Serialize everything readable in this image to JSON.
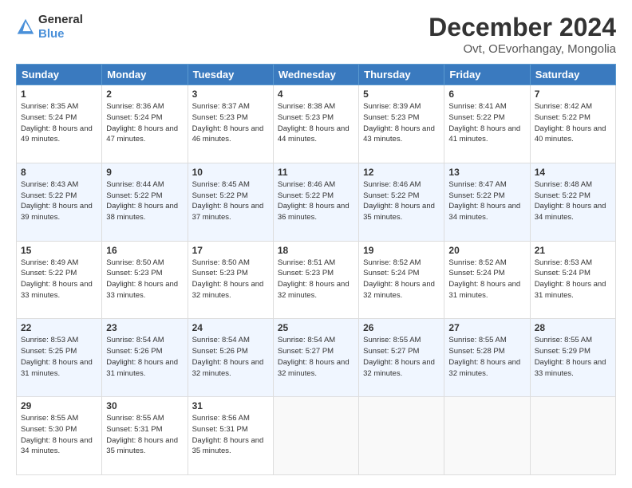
{
  "header": {
    "logo_general": "General",
    "logo_blue": "Blue",
    "main_title": "December 2024",
    "subtitle": "Ovt, OEvorhangay, Mongolia"
  },
  "calendar": {
    "headers": [
      "Sunday",
      "Monday",
      "Tuesday",
      "Wednesday",
      "Thursday",
      "Friday",
      "Saturday"
    ],
    "weeks": [
      [
        {
          "day": "1",
          "sunrise": "Sunrise: 8:35 AM",
          "sunset": "Sunset: 5:24 PM",
          "daylight": "Daylight: 8 hours and 49 minutes."
        },
        {
          "day": "2",
          "sunrise": "Sunrise: 8:36 AM",
          "sunset": "Sunset: 5:24 PM",
          "daylight": "Daylight: 8 hours and 47 minutes."
        },
        {
          "day": "3",
          "sunrise": "Sunrise: 8:37 AM",
          "sunset": "Sunset: 5:23 PM",
          "daylight": "Daylight: 8 hours and 46 minutes."
        },
        {
          "day": "4",
          "sunrise": "Sunrise: 8:38 AM",
          "sunset": "Sunset: 5:23 PM",
          "daylight": "Daylight: 8 hours and 44 minutes."
        },
        {
          "day": "5",
          "sunrise": "Sunrise: 8:39 AM",
          "sunset": "Sunset: 5:23 PM",
          "daylight": "Daylight: 8 hours and 43 minutes."
        },
        {
          "day": "6",
          "sunrise": "Sunrise: 8:41 AM",
          "sunset": "Sunset: 5:22 PM",
          "daylight": "Daylight: 8 hours and 41 minutes."
        },
        {
          "day": "7",
          "sunrise": "Sunrise: 8:42 AM",
          "sunset": "Sunset: 5:22 PM",
          "daylight": "Daylight: 8 hours and 40 minutes."
        }
      ],
      [
        {
          "day": "8",
          "sunrise": "Sunrise: 8:43 AM",
          "sunset": "Sunset: 5:22 PM",
          "daylight": "Daylight: 8 hours and 39 minutes."
        },
        {
          "day": "9",
          "sunrise": "Sunrise: 8:44 AM",
          "sunset": "Sunset: 5:22 PM",
          "daylight": "Daylight: 8 hours and 38 minutes."
        },
        {
          "day": "10",
          "sunrise": "Sunrise: 8:45 AM",
          "sunset": "Sunset: 5:22 PM",
          "daylight": "Daylight: 8 hours and 37 minutes."
        },
        {
          "day": "11",
          "sunrise": "Sunrise: 8:46 AM",
          "sunset": "Sunset: 5:22 PM",
          "daylight": "Daylight: 8 hours and 36 minutes."
        },
        {
          "day": "12",
          "sunrise": "Sunrise: 8:46 AM",
          "sunset": "Sunset: 5:22 PM",
          "daylight": "Daylight: 8 hours and 35 minutes."
        },
        {
          "day": "13",
          "sunrise": "Sunrise: 8:47 AM",
          "sunset": "Sunset: 5:22 PM",
          "daylight": "Daylight: 8 hours and 34 minutes."
        },
        {
          "day": "14",
          "sunrise": "Sunrise: 8:48 AM",
          "sunset": "Sunset: 5:22 PM",
          "daylight": "Daylight: 8 hours and 34 minutes."
        }
      ],
      [
        {
          "day": "15",
          "sunrise": "Sunrise: 8:49 AM",
          "sunset": "Sunset: 5:22 PM",
          "daylight": "Daylight: 8 hours and 33 minutes."
        },
        {
          "day": "16",
          "sunrise": "Sunrise: 8:50 AM",
          "sunset": "Sunset: 5:23 PM",
          "daylight": "Daylight: 8 hours and 33 minutes."
        },
        {
          "day": "17",
          "sunrise": "Sunrise: 8:50 AM",
          "sunset": "Sunset: 5:23 PM",
          "daylight": "Daylight: 8 hours and 32 minutes."
        },
        {
          "day": "18",
          "sunrise": "Sunrise: 8:51 AM",
          "sunset": "Sunset: 5:23 PM",
          "daylight": "Daylight: 8 hours and 32 minutes."
        },
        {
          "day": "19",
          "sunrise": "Sunrise: 8:52 AM",
          "sunset": "Sunset: 5:24 PM",
          "daylight": "Daylight: 8 hours and 32 minutes."
        },
        {
          "day": "20",
          "sunrise": "Sunrise: 8:52 AM",
          "sunset": "Sunset: 5:24 PM",
          "daylight": "Daylight: 8 hours and 31 minutes."
        },
        {
          "day": "21",
          "sunrise": "Sunrise: 8:53 AM",
          "sunset": "Sunset: 5:24 PM",
          "daylight": "Daylight: 8 hours and 31 minutes."
        }
      ],
      [
        {
          "day": "22",
          "sunrise": "Sunrise: 8:53 AM",
          "sunset": "Sunset: 5:25 PM",
          "daylight": "Daylight: 8 hours and 31 minutes."
        },
        {
          "day": "23",
          "sunrise": "Sunrise: 8:54 AM",
          "sunset": "Sunset: 5:26 PM",
          "daylight": "Daylight: 8 hours and 31 minutes."
        },
        {
          "day": "24",
          "sunrise": "Sunrise: 8:54 AM",
          "sunset": "Sunset: 5:26 PM",
          "daylight": "Daylight: 8 hours and 32 minutes."
        },
        {
          "day": "25",
          "sunrise": "Sunrise: 8:54 AM",
          "sunset": "Sunset: 5:27 PM",
          "daylight": "Daylight: 8 hours and 32 minutes."
        },
        {
          "day": "26",
          "sunrise": "Sunrise: 8:55 AM",
          "sunset": "Sunset: 5:27 PM",
          "daylight": "Daylight: 8 hours and 32 minutes."
        },
        {
          "day": "27",
          "sunrise": "Sunrise: 8:55 AM",
          "sunset": "Sunset: 5:28 PM",
          "daylight": "Daylight: 8 hours and 32 minutes."
        },
        {
          "day": "28",
          "sunrise": "Sunrise: 8:55 AM",
          "sunset": "Sunset: 5:29 PM",
          "daylight": "Daylight: 8 hours and 33 minutes."
        }
      ],
      [
        {
          "day": "29",
          "sunrise": "Sunrise: 8:55 AM",
          "sunset": "Sunset: 5:30 PM",
          "daylight": "Daylight: 8 hours and 34 minutes."
        },
        {
          "day": "30",
          "sunrise": "Sunrise: 8:55 AM",
          "sunset": "Sunset: 5:31 PM",
          "daylight": "Daylight: 8 hours and 35 minutes."
        },
        {
          "day": "31",
          "sunrise": "Sunrise: 8:56 AM",
          "sunset": "Sunset: 5:31 PM",
          "daylight": "Daylight: 8 hours and 35 minutes."
        },
        null,
        null,
        null,
        null
      ]
    ]
  }
}
